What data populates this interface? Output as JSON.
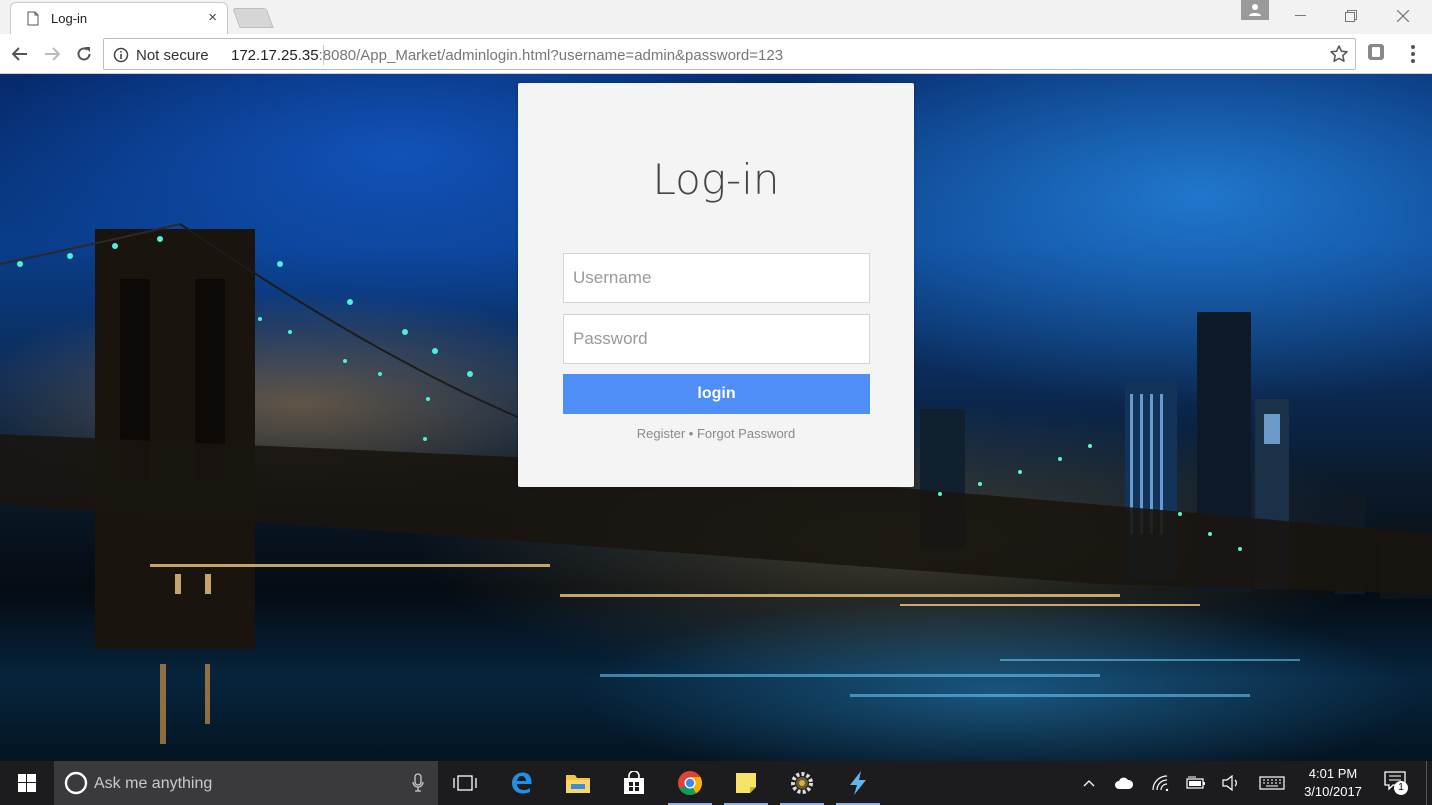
{
  "browser": {
    "tab_title": "Log-in",
    "tab_close": "×",
    "security_label": "Not secure",
    "url_host": "172.17.25.35",
    "url_rest": ":8080/App_Market/adminlogin.html?username=admin&password=123"
  },
  "login": {
    "title": "Log-in",
    "username_placeholder": "Username",
    "password_placeholder": "Password",
    "button_label": "login",
    "register_link": "Register",
    "separator": "•",
    "forgot_link": "Forgot Password"
  },
  "taskbar": {
    "search_placeholder": "Ask me anything",
    "time": "4:01 PM",
    "date": "3/10/2017",
    "notification_count": "1"
  },
  "colors": {
    "login_button": "#4f8ef7",
    "card_background": "#f4f4f4",
    "taskbar": "#1c1c1f"
  }
}
